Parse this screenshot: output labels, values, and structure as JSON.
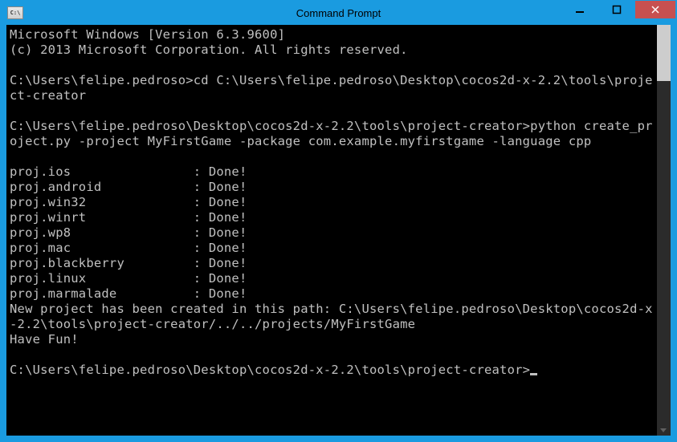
{
  "window": {
    "title": "Command Prompt",
    "icon_label": "C:\\"
  },
  "terminal": {
    "lines": [
      "Microsoft Windows [Version 6.3.9600]",
      "(c) 2013 Microsoft Corporation. All rights reserved.",
      "",
      "C:\\Users\\felipe.pedroso>cd C:\\Users\\felipe.pedroso\\Desktop\\cocos2d-x-2.2\\tools\\project-creator",
      "",
      "C:\\Users\\felipe.pedroso\\Desktop\\cocos2d-x-2.2\\tools\\project-creator>python create_project.py -project MyFirstGame -package com.example.myfirstgame -language cpp",
      "",
      "proj.ios\t\t: Done!",
      "proj.android\t\t: Done!",
      "proj.win32\t\t: Done!",
      "proj.winrt\t\t: Done!",
      "proj.wp8\t\t: Done!",
      "proj.mac\t\t: Done!",
      "proj.blackberry\t\t: Done!",
      "proj.linux\t\t: Done!",
      "proj.marmalade\t\t: Done!",
      "New project has been created in this path: C:\\Users\\felipe.pedroso\\Desktop\\cocos2d-x-2.2\\tools\\project-creator/../../projects/MyFirstGame",
      "Have Fun!",
      ""
    ],
    "prompt": "C:\\Users\\felipe.pedroso\\Desktop\\cocos2d-x-2.2\\tools\\project-creator>"
  }
}
